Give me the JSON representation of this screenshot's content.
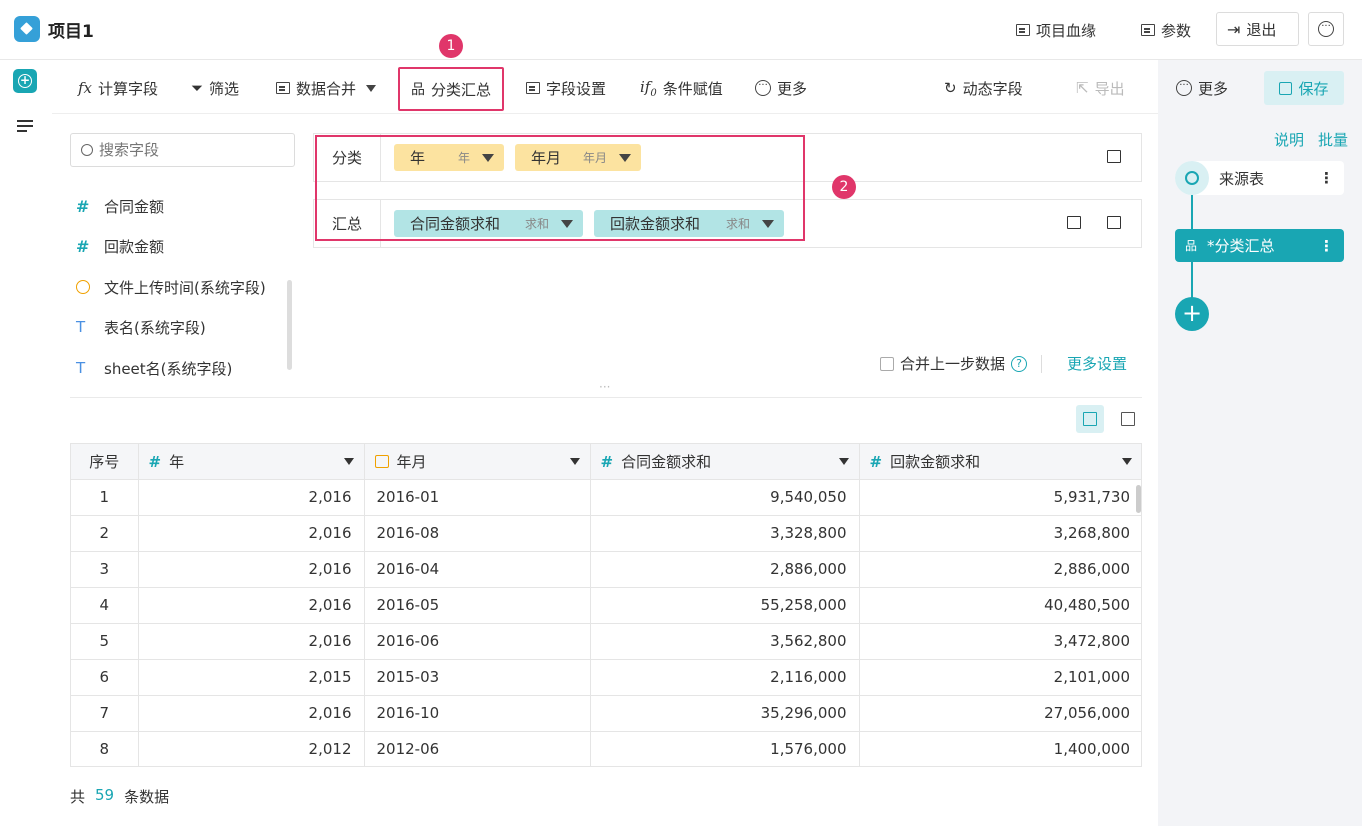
{
  "app": {
    "title": "项目1"
  },
  "topbar": {
    "lineage": "项目血缘",
    "params": "参数",
    "exit": "退出",
    "more_icon": "more-circle-icon"
  },
  "toolbar": {
    "calc_field": "计算字段",
    "filter": "筛选",
    "data_merge": "数据合并",
    "group_summary": "分类汇总",
    "field_settings": "字段设置",
    "conditional": "条件赋值",
    "more": "更多",
    "dynamic_field": "动态字段",
    "export": "导出",
    "more2": "更多",
    "save": "保存"
  },
  "badges": {
    "one": "1",
    "two": "2"
  },
  "search": {
    "placeholder": "搜索字段"
  },
  "fields": [
    {
      "name": "合同金额",
      "type": "number"
    },
    {
      "name": "回款金额",
      "type": "number"
    },
    {
      "name": "文件上传时间(系统字段)",
      "type": "time"
    },
    {
      "name": "表名(系统字段)",
      "type": "text"
    },
    {
      "name": "sheet名(系统字段)",
      "type": "text"
    }
  ],
  "config": {
    "group_label": "分类",
    "summary_label": "汇总",
    "group_chips": [
      {
        "label": "年",
        "sub": "年"
      },
      {
        "label": "年月",
        "sub": "年月"
      }
    ],
    "summary_chips": [
      {
        "label": "合同金额求和",
        "sub": "求和"
      },
      {
        "label": "回款金额求和",
        "sub": "求和"
      }
    ]
  },
  "options": {
    "merge_prev": "合并上一步数据",
    "more_settings": "更多设置",
    "help": "?"
  },
  "table": {
    "headers": [
      "序号",
      "年",
      "年月",
      "合同金额求和",
      "回款金额求和"
    ],
    "rows": [
      [
        "1",
        "2,016",
        "2016-01",
        "9,540,050",
        "5,931,730"
      ],
      [
        "2",
        "2,016",
        "2016-08",
        "3,328,800",
        "3,268,800"
      ],
      [
        "3",
        "2,016",
        "2016-04",
        "2,886,000",
        "2,886,000"
      ],
      [
        "4",
        "2,016",
        "2016-05",
        "55,258,000",
        "40,480,500"
      ],
      [
        "5",
        "2,016",
        "2016-06",
        "3,562,800",
        "3,472,800"
      ],
      [
        "6",
        "2,015",
        "2015-03",
        "2,116,000",
        "2,101,000"
      ],
      [
        "7",
        "2,016",
        "2016-10",
        "35,296,000",
        "27,056,000"
      ],
      [
        "8",
        "2,012",
        "2012-06",
        "1,576,000",
        "1,400,000"
      ]
    ]
  },
  "footer": {
    "prefix": "共",
    "count": "59",
    "suffix": "条数据"
  },
  "right": {
    "explain": "说明",
    "batch": "批量",
    "source_node": "来源表",
    "summary_node": "*分类汇总"
  },
  "colors": {
    "accent": "#19a6b3",
    "highlight": "#e0366a",
    "chip_yellow": "#fce3a0",
    "chip_teal": "#b2e4e5"
  }
}
